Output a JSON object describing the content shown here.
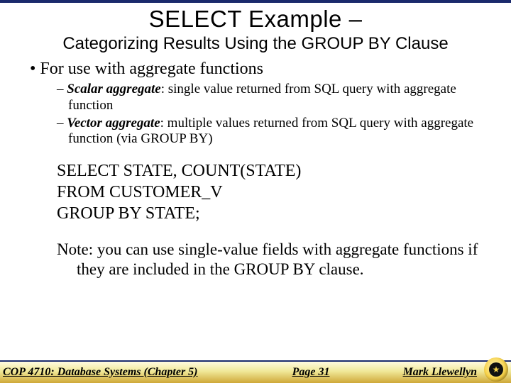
{
  "title": {
    "main": "SELECT Example –",
    "sub": "Categorizing Results Using the GROUP BY Clause"
  },
  "bullet_main": "For use with aggregate functions",
  "sub_bullets": [
    {
      "term": "Scalar aggregate",
      "rest": ": single value returned from SQL query with aggregate function"
    },
    {
      "term": "Vector aggregate",
      "rest": ": multiple values returned from SQL query with aggregate function (via GROUP BY)"
    }
  ],
  "sql": {
    "line1": "SELECT STATE, COUNT(STATE)",
    "line2": "FROM CUSTOMER_V",
    "line3": "GROUP BY STATE;"
  },
  "note": "Note: you can use single-value fields with aggregate functions if they are included in the GROUP BY clause.",
  "footer": {
    "left": "COP 4710: Database Systems  (Chapter 5)",
    "center": "Page 31",
    "right": "Mark Llewellyn"
  }
}
